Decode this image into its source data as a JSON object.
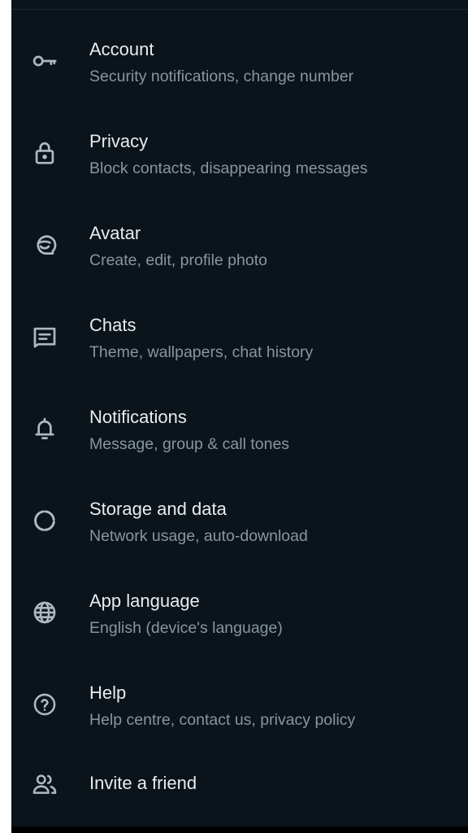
{
  "colors": {
    "background": "#0b141a",
    "title_text": "#e9edef",
    "subtitle_text": "#8696a0",
    "icon": "#aebac1"
  },
  "settings": {
    "items": [
      {
        "title": "Account",
        "subtitle": "Security notifications, change number",
        "icon": "key-icon"
      },
      {
        "title": "Privacy",
        "subtitle": "Block contacts, disappearing messages",
        "icon": "lock-icon"
      },
      {
        "title": "Avatar",
        "subtitle": "Create, edit, profile photo",
        "icon": "avatar-icon"
      },
      {
        "title": "Chats",
        "subtitle": "Theme, wallpapers, chat history",
        "icon": "chat-icon"
      },
      {
        "title": "Notifications",
        "subtitle": "Message, group & call tones",
        "icon": "bell-icon"
      },
      {
        "title": "Storage and data",
        "subtitle": "Network usage, auto-download",
        "icon": "storage-icon"
      },
      {
        "title": "App language",
        "subtitle": "English (device's language)",
        "icon": "globe-icon"
      },
      {
        "title": "Help",
        "subtitle": "Help centre, contact us, privacy policy",
        "icon": "help-icon"
      },
      {
        "title": "Invite a friend",
        "subtitle": "",
        "icon": "people-icon"
      }
    ]
  }
}
